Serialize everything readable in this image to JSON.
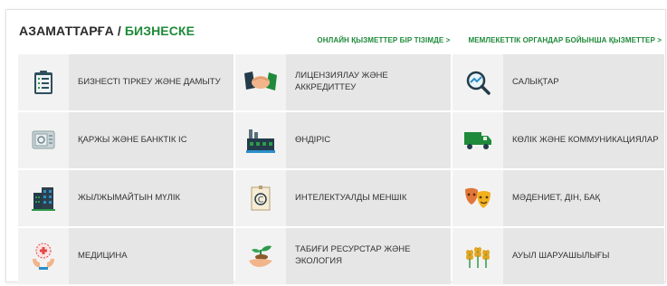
{
  "header": {
    "part1": "АЗАМАТТАРҒА /",
    "part2": "БИЗНЕСКЕ"
  },
  "links": {
    "online_services": "ОНЛАЙН ҚЫЗМЕТТЕР БІР ТІЗІМДЕ >",
    "gov_services": "МЕМЛЕКЕТТІК ОРГАНДАР БОЙЫНША ҚЫЗМЕТТЕР >"
  },
  "categories": [
    {
      "label": "БИЗНЕСТІ ТІРКЕУ ЖӘНЕ ДАМЫТУ",
      "icon": "clipboard-icon"
    },
    {
      "label": "ЛИЦЕНЗИЯЛАУ ЖӘНЕ АККРЕДИТТЕУ",
      "icon": "handshake-icon"
    },
    {
      "label": "САЛЫҚТАР",
      "icon": "magnifier-chart-icon"
    },
    {
      "label": "ҚАРЖЫ ЖӘНЕ БАНКТІК ІС",
      "icon": "safe-icon"
    },
    {
      "label": "ӨНДІРІС",
      "icon": "factory-icon"
    },
    {
      "label": "КӨЛІК ЖӘНЕ КОММУНИКАЦИЯЛАР",
      "icon": "truck-icon"
    },
    {
      "label": "ЖЫЛЖЫМАЙТЫН МҮЛІК",
      "icon": "buildings-icon"
    },
    {
      "label": "ИНТЕЛЕКТУАЛДЫ МЕНШІК",
      "icon": "copyright-document-icon"
    },
    {
      "label": "МӘДЕНИЕТ, ДІН, БАҚ",
      "icon": "theater-masks-icon"
    },
    {
      "label": "МЕДИЦИНА",
      "icon": "medical-hands-icon"
    },
    {
      "label": "ТАБИҒИ РЕСУРСТАР ЖӘНЕ ЭКОЛОГИЯ",
      "icon": "plant-hand-icon"
    },
    {
      "label": "АУЫЛ ШАРУАШЫЛЫҒЫ",
      "icon": "wheat-icon"
    }
  ]
}
